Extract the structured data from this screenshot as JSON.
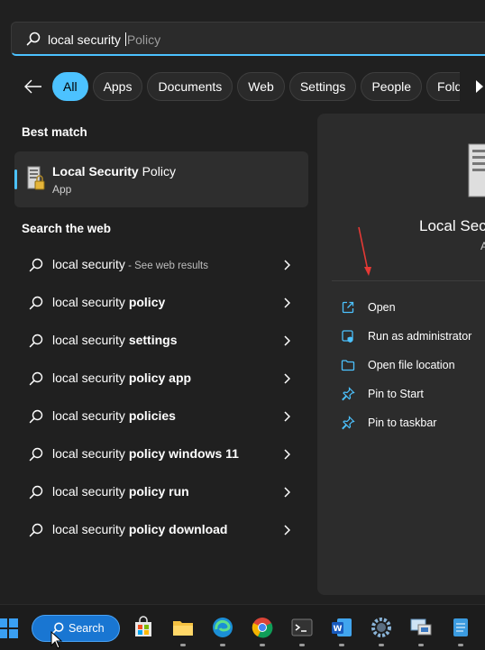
{
  "search": {
    "typed": "local security ",
    "suggestion": "Policy"
  },
  "filters": {
    "chips": [
      "All",
      "Apps",
      "Documents",
      "Web",
      "Settings",
      "People",
      "Folde"
    ]
  },
  "best_match": {
    "section_label": "Best match",
    "title_bold": "Local Security",
    "title_rest": " Policy",
    "subtitle": "App"
  },
  "web": {
    "section_label": "Search the web",
    "results": [
      {
        "plain": "local security",
        "bold": "",
        "hint": " - See web results"
      },
      {
        "plain": "local security ",
        "bold": "policy",
        "hint": ""
      },
      {
        "plain": "local security ",
        "bold": "settings",
        "hint": ""
      },
      {
        "plain": "local security ",
        "bold": "policy app",
        "hint": ""
      },
      {
        "plain": "local security ",
        "bold": "policies",
        "hint": ""
      },
      {
        "plain": "local security ",
        "bold": "policy windows 11",
        "hint": ""
      },
      {
        "plain": "local security ",
        "bold": "policy run",
        "hint": ""
      },
      {
        "plain": "local security ",
        "bold": "policy download",
        "hint": ""
      }
    ]
  },
  "preview": {
    "title": "Local Secu",
    "subtitle": "A",
    "actions": [
      {
        "label": "Open",
        "icon": "open-external-icon"
      },
      {
        "label": "Run as administrator",
        "icon": "shield-admin-icon"
      },
      {
        "label": "Open file location",
        "icon": "folder-icon"
      },
      {
        "label": "Pin to Start",
        "icon": "pin-icon"
      },
      {
        "label": "Pin to taskbar",
        "icon": "pin-icon"
      }
    ]
  },
  "taskbar": {
    "search_label": "Search",
    "apps": [
      "start-icon",
      "store-icon",
      "file-explorer-icon",
      "edge-icon",
      "chrome-icon",
      "terminal-icon",
      "word-icon",
      "settings-gear-icon",
      "remote-desktop-icon",
      "notepad-icon"
    ]
  },
  "colors": {
    "accent": "#4cc2ff",
    "panel_bg": "#202020",
    "annotation": "#e53935"
  }
}
